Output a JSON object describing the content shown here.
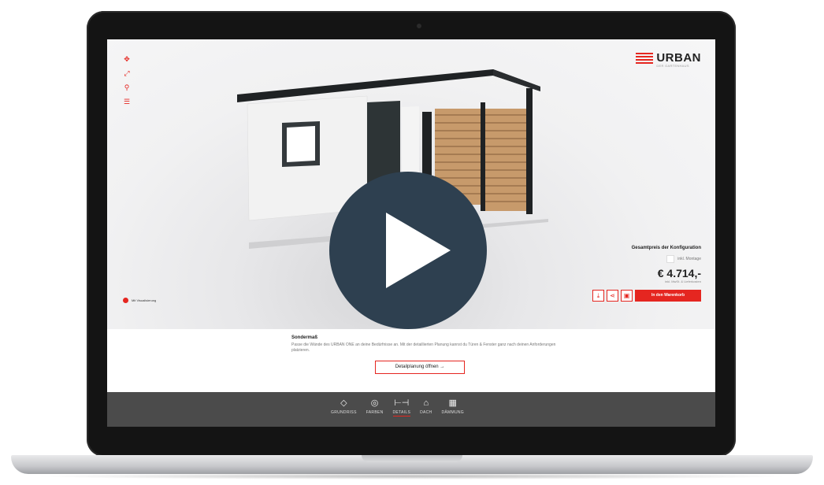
{
  "app": {
    "logo": "URBAN",
    "logo_sub": "DER GARTENHAUS"
  },
  "viewer": {
    "viz_note": "Mit Visualisierung"
  },
  "price_panel": {
    "title": "Gesamtpreis der Konfiguration",
    "montage_label": "inkl. Montage",
    "price": "€ 4.714,-",
    "price_sub": "inkl. MwSt. & Lieferkosten",
    "cart_label": "In den Warenkorb"
  },
  "info": {
    "title": "Sondermaß",
    "description": "Passe die Wände des URBAN ONE an deine Bedürfnisse an. Mit der detaillierten Planung kannst du Türen & Fenster ganz nach deinen Anforderungen platzieren.",
    "detail_button": "Detailplanung öffnen →"
  },
  "bottom_nav": {
    "items": [
      {
        "label": "GRUNDRISS",
        "icon": "◇"
      },
      {
        "label": "FARBEN",
        "icon": "◎"
      },
      {
        "label": "DETAILS",
        "icon": "⊢⊣",
        "active": true
      },
      {
        "label": "DACH",
        "icon": "⌂"
      },
      {
        "label": "DÄMMUNG",
        "icon": "▦"
      }
    ]
  },
  "colors": {
    "accent": "#e52620",
    "nav_bg": "#4b4b4b",
    "play_bg": "#2e4050"
  }
}
